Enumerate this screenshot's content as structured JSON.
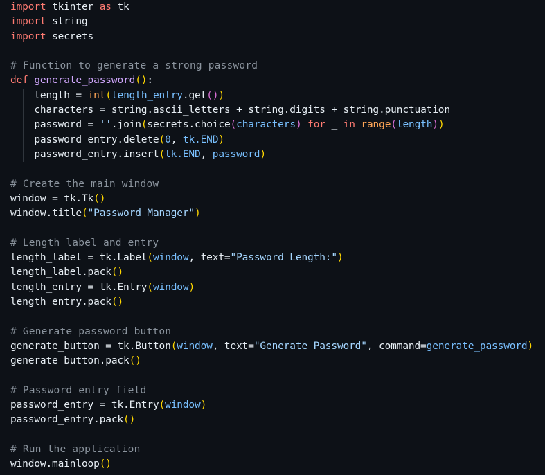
{
  "editor": {
    "language": "python",
    "colors": {
      "background": "#0d1117",
      "plain": "#e6edf3",
      "keyword": "#ff7b72",
      "keyword_alt": "#d2a8ff",
      "function": "#d2a8ff",
      "builtin": "#ffa657",
      "string": "#a5d6ff",
      "number": "#79c0ff",
      "comment": "#8b949e",
      "param": "#79c0ff",
      "bracket_1": "#ffd700",
      "bracket_2": "#da70d6",
      "bracket_3": "#179fff"
    },
    "lines": [
      [
        {
          "t": "import",
          "k": "kw"
        },
        {
          "t": " tkinter ",
          "k": "id"
        },
        {
          "t": "as",
          "k": "kw"
        },
        {
          "t": " tk",
          "k": "id"
        }
      ],
      [
        {
          "t": "import",
          "k": "kw"
        },
        {
          "t": " string",
          "k": "id"
        }
      ],
      [
        {
          "t": "import",
          "k": "kw"
        },
        {
          "t": " secrets",
          "k": "id"
        }
      ],
      [],
      [
        {
          "t": "# Function to generate a strong password",
          "k": "cm"
        }
      ],
      [
        {
          "t": "def",
          "k": "kw"
        },
        {
          "t": " ",
          "k": "id"
        },
        {
          "t": "generate_password",
          "k": "fn"
        },
        {
          "t": "()",
          "k": "b1"
        },
        {
          "t": ":",
          "k": "id"
        }
      ],
      [
        {
          "t": "    length ",
          "k": "id",
          "guide": true
        },
        {
          "t": "=",
          "k": "op"
        },
        {
          "t": " ",
          "k": "id"
        },
        {
          "t": "int",
          "k": "bi"
        },
        {
          "t": "(",
          "k": "b1"
        },
        {
          "t": "length_entry",
          "k": "pm"
        },
        {
          "t": ".get",
          "k": "id"
        },
        {
          "t": "()",
          "k": "b2"
        },
        {
          "t": ")",
          "k": "b1"
        }
      ],
      [
        {
          "t": "    characters ",
          "k": "id",
          "guide": true
        },
        {
          "t": "=",
          "k": "op"
        },
        {
          "t": " string.ascii_letters ",
          "k": "id"
        },
        {
          "t": "+",
          "k": "op"
        },
        {
          "t": " string.digits ",
          "k": "id"
        },
        {
          "t": "+",
          "k": "op"
        },
        {
          "t": " string.punctuation",
          "k": "id"
        }
      ],
      [
        {
          "t": "    password ",
          "k": "id",
          "guide": true
        },
        {
          "t": "=",
          "k": "op"
        },
        {
          "t": " ",
          "k": "id"
        },
        {
          "t": "''",
          "k": "st"
        },
        {
          "t": ".join",
          "k": "id"
        },
        {
          "t": "(",
          "k": "b1"
        },
        {
          "t": "secrets.choice",
          "k": "id"
        },
        {
          "t": "(",
          "k": "b2"
        },
        {
          "t": "characters",
          "k": "pm"
        },
        {
          "t": ")",
          "k": "b2"
        },
        {
          "t": " ",
          "k": "id"
        },
        {
          "t": "for",
          "k": "kw"
        },
        {
          "t": " _ ",
          "k": "id"
        },
        {
          "t": "in",
          "k": "kw"
        },
        {
          "t": " ",
          "k": "id"
        },
        {
          "t": "range",
          "k": "bi"
        },
        {
          "t": "(",
          "k": "b2"
        },
        {
          "t": "length",
          "k": "pm"
        },
        {
          "t": ")",
          "k": "b2"
        },
        {
          "t": ")",
          "k": "b1"
        }
      ],
      [
        {
          "t": "    password_entry.delete",
          "k": "id",
          "guide": true
        },
        {
          "t": "(",
          "k": "b1"
        },
        {
          "t": "0",
          "k": "nm"
        },
        {
          "t": ", ",
          "k": "id"
        },
        {
          "t": "tk.END",
          "k": "pm"
        },
        {
          "t": ")",
          "k": "b1"
        }
      ],
      [
        {
          "t": "    password_entry.insert",
          "k": "id",
          "guide": true
        },
        {
          "t": "(",
          "k": "b1"
        },
        {
          "t": "tk.END",
          "k": "pm"
        },
        {
          "t": ", ",
          "k": "id"
        },
        {
          "t": "password",
          "k": "pm"
        },
        {
          "t": ")",
          "k": "b1"
        }
      ],
      [],
      [
        {
          "t": "# Create the main window",
          "k": "cm"
        }
      ],
      [
        {
          "t": "window ",
          "k": "id"
        },
        {
          "t": "=",
          "k": "op"
        },
        {
          "t": " tk.Tk",
          "k": "id"
        },
        {
          "t": "()",
          "k": "b1"
        }
      ],
      [
        {
          "t": "window.title",
          "k": "id"
        },
        {
          "t": "(",
          "k": "b1"
        },
        {
          "t": "\"Password Manager\"",
          "k": "st"
        },
        {
          "t": ")",
          "k": "b1"
        }
      ],
      [],
      [
        {
          "t": "# Length label and entry",
          "k": "cm"
        }
      ],
      [
        {
          "t": "length_label ",
          "k": "id"
        },
        {
          "t": "=",
          "k": "op"
        },
        {
          "t": " tk.Label",
          "k": "id"
        },
        {
          "t": "(",
          "k": "b1"
        },
        {
          "t": "window",
          "k": "pm"
        },
        {
          "t": ", text=",
          "k": "id"
        },
        {
          "t": "\"Password Length:\"",
          "k": "st"
        },
        {
          "t": ")",
          "k": "b1"
        }
      ],
      [
        {
          "t": "length_label.pack",
          "k": "id"
        },
        {
          "t": "()",
          "k": "b1"
        }
      ],
      [
        {
          "t": "length_entry ",
          "k": "id"
        },
        {
          "t": "=",
          "k": "op"
        },
        {
          "t": " tk.Entry",
          "k": "id"
        },
        {
          "t": "(",
          "k": "b1"
        },
        {
          "t": "window",
          "k": "pm"
        },
        {
          "t": ")",
          "k": "b1"
        }
      ],
      [
        {
          "t": "length_entry.pack",
          "k": "id"
        },
        {
          "t": "()",
          "k": "b1"
        }
      ],
      [],
      [
        {
          "t": "# Generate password button",
          "k": "cm"
        }
      ],
      [
        {
          "t": "generate_button ",
          "k": "id"
        },
        {
          "t": "=",
          "k": "op"
        },
        {
          "t": " tk.Button",
          "k": "id"
        },
        {
          "t": "(",
          "k": "b1"
        },
        {
          "t": "window",
          "k": "pm"
        },
        {
          "t": ", text=",
          "k": "id"
        },
        {
          "t": "\"Generate Password\"",
          "k": "st"
        },
        {
          "t": ", command=",
          "k": "id"
        },
        {
          "t": "generate_password",
          "k": "pm"
        },
        {
          "t": ")",
          "k": "b1"
        }
      ],
      [
        {
          "t": "generate_button.pack",
          "k": "id"
        },
        {
          "t": "()",
          "k": "b1"
        }
      ],
      [],
      [
        {
          "t": "# Password entry field",
          "k": "cm"
        }
      ],
      [
        {
          "t": "password_entry ",
          "k": "id"
        },
        {
          "t": "=",
          "k": "op"
        },
        {
          "t": " tk.Entry",
          "k": "id"
        },
        {
          "t": "(",
          "k": "b1"
        },
        {
          "t": "window",
          "k": "pm"
        },
        {
          "t": ")",
          "k": "b1"
        }
      ],
      [
        {
          "t": "password_entry.pack",
          "k": "id"
        },
        {
          "t": "()",
          "k": "b1"
        }
      ],
      [],
      [
        {
          "t": "# Run the application",
          "k": "cm"
        }
      ],
      [
        {
          "t": "window.mainloop",
          "k": "id"
        },
        {
          "t": "()",
          "k": "b1"
        }
      ]
    ]
  }
}
